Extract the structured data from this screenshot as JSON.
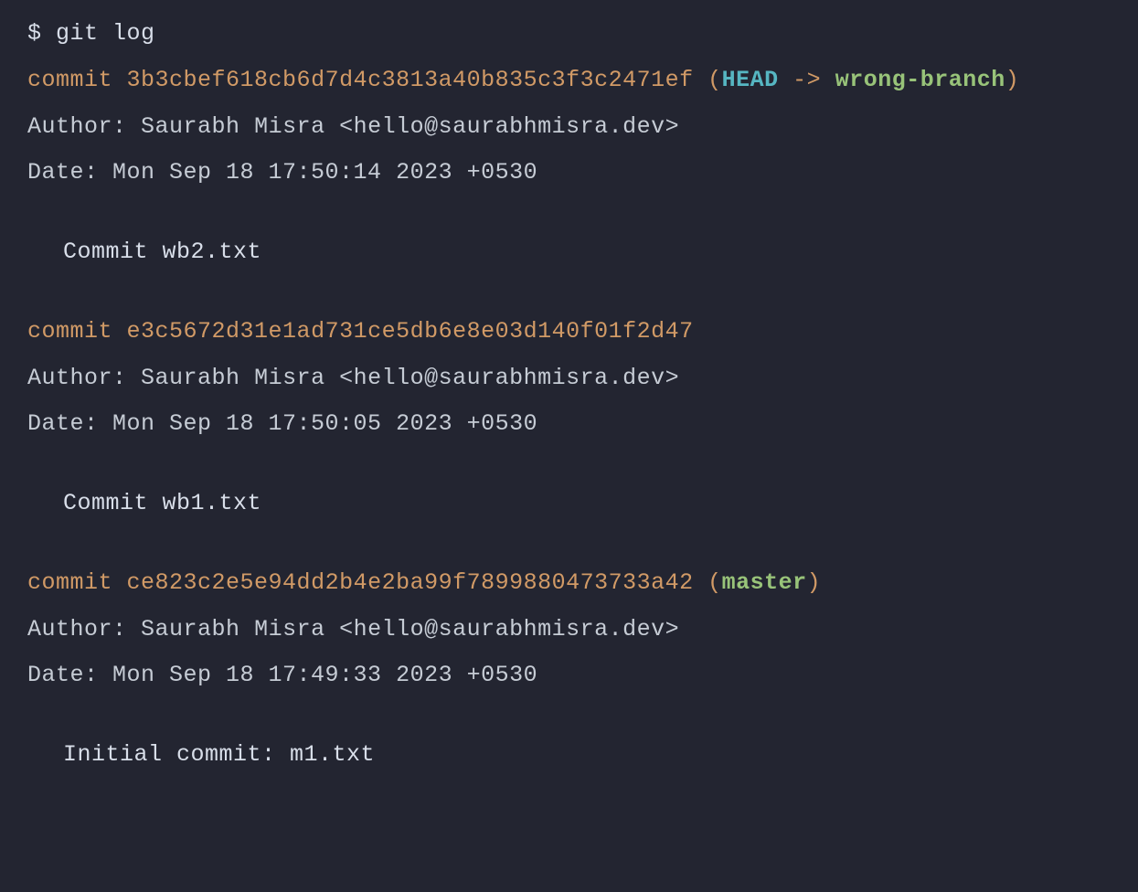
{
  "prompt": {
    "symbol": "$",
    "command": "git log"
  },
  "commits": [
    {
      "commit_label": "commit",
      "hash": "3b3cbef618cb6d7d4c3813a40b835c3f3c2471ef",
      "refs": {
        "open": " (",
        "head": "HEAD",
        "arrow": " -> ",
        "branch": "wrong-branch",
        "close": ")"
      },
      "author_label": "Author:",
      "author": "Saurabh Misra <hello@saurabhmisra.dev>",
      "date_label": "Date:  ",
      "date": "Mon Sep 18 17:50:14 2023 +0530",
      "message": "Commit wb2.txt"
    },
    {
      "commit_label": "commit",
      "hash": "e3c5672d31e1ad731ce5db6e8e03d140f01f2d47",
      "refs": null,
      "author_label": "Author:",
      "author": "Saurabh Misra <hello@saurabhmisra.dev>",
      "date_label": "Date:  ",
      "date": "Mon Sep 18 17:50:05 2023 +0530",
      "message": "Commit wb1.txt"
    },
    {
      "commit_label": "commit",
      "hash": "ce823c2e5e94dd2b4e2ba99f7899880473733a42",
      "refs": {
        "open": " (",
        "head": null,
        "arrow": null,
        "branch": "master",
        "close": ")"
      },
      "author_label": "Author:",
      "author": "Saurabh Misra <hello@saurabhmisra.dev>",
      "date_label": "Date:  ",
      "date": "Mon Sep 18 17:49:33 2023 +0530",
      "message": "Initial commit:  m1.txt"
    }
  ]
}
